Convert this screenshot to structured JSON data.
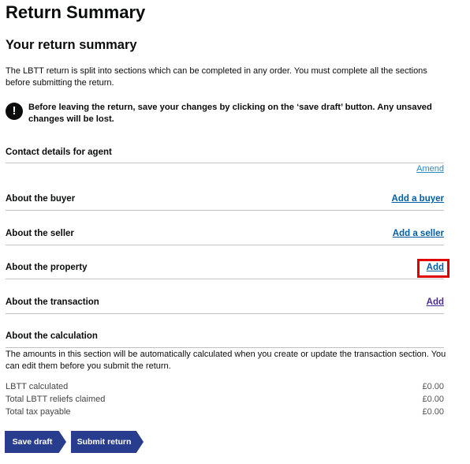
{
  "page": {
    "title": "Return Summary",
    "subtitle": "Your return summary",
    "intro": "The LBTT return is split into sections which can be completed in any order. You must complete all the sections before submitting the return.",
    "warning": "Before leaving the return, save your changes by clicking on the ‘save draft’ button. Any unsaved changes will be lost.",
    "warning_icon": "!"
  },
  "sections": {
    "agent": {
      "title": "Contact details for agent",
      "link": "Amend"
    },
    "buyer": {
      "title": "About the buyer",
      "link": "Add a buyer"
    },
    "seller": {
      "title": "About the seller",
      "link": "Add a seller"
    },
    "property": {
      "title": "About the property",
      "link": "Add"
    },
    "transaction": {
      "title": "About the transaction",
      "link": "Add"
    },
    "calculation": {
      "title": "About the calculation",
      "text": "The amounts in this section will be automatically calculated when you create or update the transaction section. You can edit them before you submit the return.",
      "rows": [
        {
          "label": "LBTT calculated",
          "value": "£0.00"
        },
        {
          "label": "Total LBTT reliefs claimed",
          "value": "£0.00"
        },
        {
          "label": "Total tax payable",
          "value": "£0.00"
        }
      ]
    }
  },
  "buttons": {
    "save": "Save draft",
    "submit": "Submit return"
  },
  "colors": {
    "button": "#293d8e",
    "link": "#005ea5",
    "highlight": "#e00000"
  }
}
